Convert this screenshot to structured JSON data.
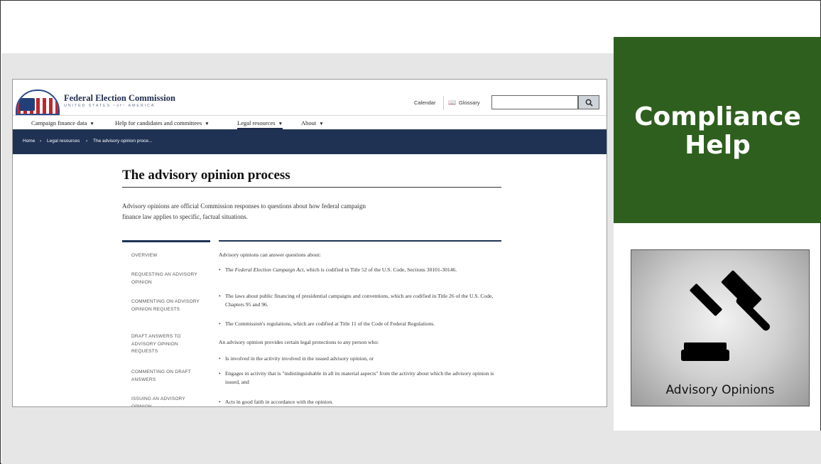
{
  "site": {
    "name": "Federal Election Commission",
    "tagline": "UNITED STATES ~of~ AMERICA",
    "utility": {
      "calendar": "Calendar",
      "glossary": "Glossary",
      "search_value": ""
    },
    "nav": [
      {
        "label": "Campaign finance data",
        "caret": "▼"
      },
      {
        "label": "Help for candidates and committees",
        "caret": "▼"
      },
      {
        "label": "Legal resources",
        "caret": "▼"
      },
      {
        "label": "About",
        "caret": "▼"
      }
    ],
    "breadcrumb": [
      "Home",
      "›",
      "Legal resources",
      "›",
      "The advisory opinion proce..."
    ]
  },
  "page": {
    "title": "The advisory opinion process",
    "intro": "Advisory opinions are official Commission responses to questions about how federal campaign finance law applies to specific, factual situations.",
    "sidebar": [
      "OVERVIEW",
      "REQUESTING AN ADVISORY OPINION",
      "COMMENTING ON ADVISORY OPINION REQUESTS",
      "DRAFT ANSWERS TO ADVISORY OPINION REQUESTS",
      "COMMENTING ON DRAFT ANSWERS",
      "ISSUING AN ADVISORY OPINION"
    ],
    "body": {
      "lead1": "Advisory opinions can answer questions about:",
      "bullets1": [
        {
          "pre": "The ",
          "italic": "Federal Election Campaign Act",
          "post": ", which is codified in Title 52 of the U.S. Code, Sections 30101-30146."
        },
        {
          "pre": "The laws about public financing of presidential campaigns and conventions, which are codified in Title 26 of the U.S. Code, Chapters 95 and 96.",
          "italic": "",
          "post": ""
        },
        {
          "pre": "The Commission's regulations, which are codified at Title 11 of the Code of Federal Regulations.",
          "italic": "",
          "post": ""
        }
      ],
      "lead2": "An advisory opinion provides certain legal protections to any person who:",
      "bullets2": [
        "Is involved in the activity involved in the issued advisory opinion, or",
        "Engages in activity that is \"indistinguishable in all its material aspects\" from the activity about which the advisory opinion is issued, and",
        "Acts in good faith in accordance with the opinion."
      ]
    }
  },
  "panel": {
    "title_line1": "Compliance",
    "title_line2": "Help",
    "card_label": "Advisory Opinions",
    "card_icon": "gavel-icon"
  },
  "colors": {
    "green": "#2e5f1e",
    "navy": "#1f3254"
  }
}
